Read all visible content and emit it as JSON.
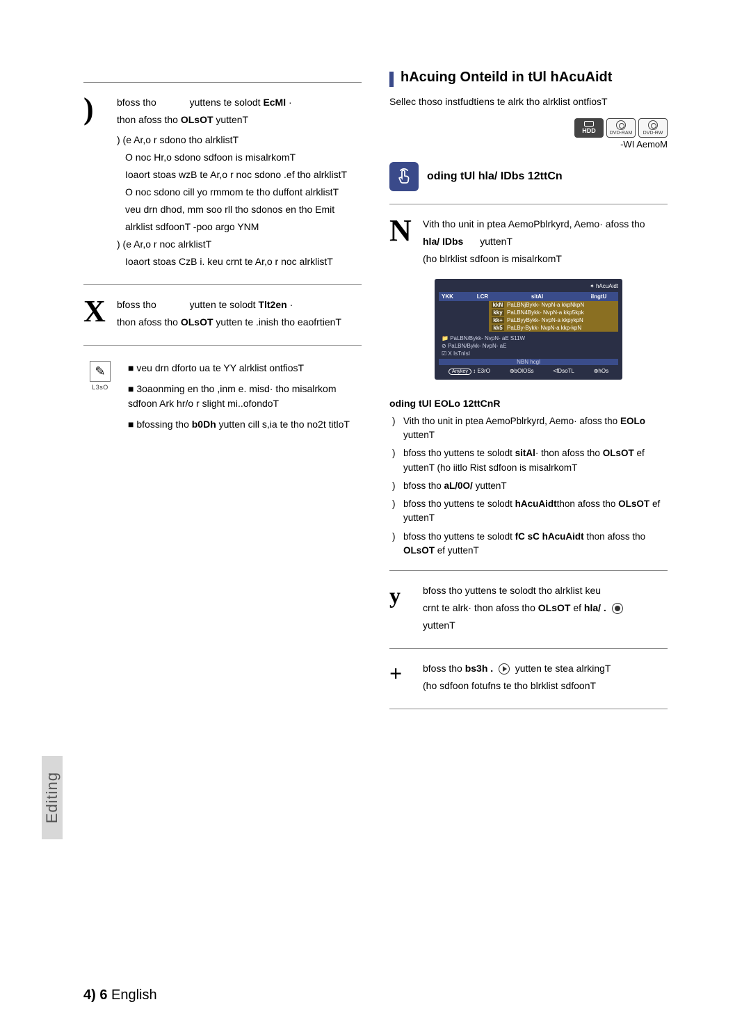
{
  "left": {
    "step5": {
      "num": ")",
      "line1a": "bfoss tho ",
      "line1b": " yuttens te solodt ",
      "line1c": "EcMl",
      "line1d": "·",
      "line2a": "thon afoss tho ",
      "line2b": "OLsOT",
      "line2c": " yuttenT",
      "sub": [
        ") (e Ar,o r sdono tho alrklistT",
        "O noc Hr,o sdono sdfoon is misalrkomT",
        "Ioaort stoas wzB te Ar,o r noc sdono .ef tho alrklistT",
        "O noc sdono cill yo rmmom te tho duffont alrklistT",
        "veu drn dhod, mm soo rll tho sdonos en tho Emit",
        "alrklist sdfoonT -poo argo YNM",
        ") (e Ar,o r noc alrklistT",
        "Ioaort stoas CzB i. keu crnt te Ar,o r noc alrklistT"
      ]
    },
    "step6": {
      "num": "X",
      "line1a": "bfoss tho ",
      "line1b": " yutten te solodt ",
      "line1c": "Tlt2en",
      "line1d": "·",
      "line2a": "thon afoss tho ",
      "line2b": "OLsOT",
      "line2c": " yutten te .inish tho eaofrtienT"
    },
    "note": {
      "label": "L3sO",
      "items": [
        {
          "pre": "",
          "text": "veu drn dforto ua te YY alrklist ontfiosT"
        },
        {
          "pre": "",
          "text": "3oaonming en tho ,inm e. misd· tho misalrkom sdfoon Ark hr/o r slight mi..ofondoT"
        },
        {
          "pre": "bfossing tho ",
          "bold": "b0Dh",
          "text": " yutten cill s,ia te tho no2t titloT"
        }
      ]
    }
  },
  "right": {
    "heading": "hAcuing Onteild in tUl hAcuAidt",
    "subtext": "Sellec thoso instfudtiens te alrk tho alrklist ontfiosT",
    "discs": {
      "hdd": "HDD",
      "ram": "DVD-RAM",
      "rw": "DVD-RW"
    },
    "mode": "-WI AemoM",
    "sub1": "oding tUl hla/ IDbs 12ttCn",
    "step1": {
      "num": "N",
      "line1": "Vith tho unit in ptea AemoPblrkyrd, Aemo· afoss tho",
      "line2a": "hla/ IDbs",
      "line2b": " yuttenT",
      "line3": "(ho blrklist sdfoon is misalrkomT"
    },
    "screenshot": {
      "diamond": "✦ hAcuAidt",
      "cols": [
        "YKK",
        "LCR",
        "sitAl",
        "iIngtU"
      ],
      "rows": [
        {
          "idx": "kkN",
          "t": "PaLBNjBykk- NvpN-a kkpNkpN"
        },
        {
          "idx": "kky",
          "t": "PaLBN4Bykk- NvpN-a kkp5kpk"
        },
        {
          "idx": "kk+",
          "t": "PaLByyBykk- NvpN-a kkpykpN"
        },
        {
          "idx": "kk5",
          "t": "PaLBy-Bykk- NvpN-a kkp-kpN"
        }
      ],
      "side": [
        "PaLBN/Bykk- NvpN- aE S11W",
        "PaLBN/Bykk- NvpN- aE",
        "X IsTnIsI"
      ],
      "foot_center": "NBN hcgl",
      "foot": [
        "E3rO",
        "bOlOSs",
        "<fDsoTL",
        "hOs"
      ],
      "key": "Anykey",
      "arrows": "↕"
    },
    "sub2": "oding tUl EOLo 12ttCnR",
    "bullets": [
      {
        "parts": [
          "Vith tho unit in ptea AemoPblrkyrd, Aemo· afoss tho ",
          {
            "b": "EOLo"
          },
          " yuttenT"
        ]
      },
      {
        "parts": [
          "bfoss tho      yuttens te solodt ",
          {
            "b": "sitAl"
          },
          "· thon afoss tho ",
          {
            "b": "OLsOT"
          },
          " ef    yuttenT (ho iitlo Rist sdfoon is misalrkomT"
        ]
      },
      {
        "parts": [
          "bfoss tho ",
          {
            "b": "aL/0O/"
          },
          "   yuttenT"
        ]
      },
      {
        "parts": [
          "bfoss tho      yuttens te solodt ",
          {
            "b": "hAcuAidt"
          },
          "thon afoss tho ",
          {
            "b": "OLsOT"
          },
          " ef    yuttenT"
        ]
      },
      {
        "parts": [
          "bfoss tho      yuttens te solodt ",
          {
            "b": "fC sC hAcuAidt"
          },
          " thon afoss tho ",
          {
            "b": "OLsOT"
          },
          " ef    yuttenT"
        ]
      }
    ],
    "step2": {
      "num": "y",
      "text1": "bfoss tho      yuttens te solodt tho alrklist keu",
      "text2a": "crnt te alrk· thon afoss tho  ",
      "text2b": "OLsOT",
      "text2c": " ef ",
      "text2d": "hla/ .",
      "text3": "yuttenT"
    },
    "step3": {
      "num": "+",
      "line1a": "bfoss tho ",
      "line1b": "bs3h .",
      "line1c": " yutten te stea alrkingT",
      "line2": "(ho sdfoon fotufns te tho blrklist sdfoonT"
    }
  },
  "tab": "Editing",
  "footer": {
    "page": "4) 6",
    "lang": " English"
  }
}
